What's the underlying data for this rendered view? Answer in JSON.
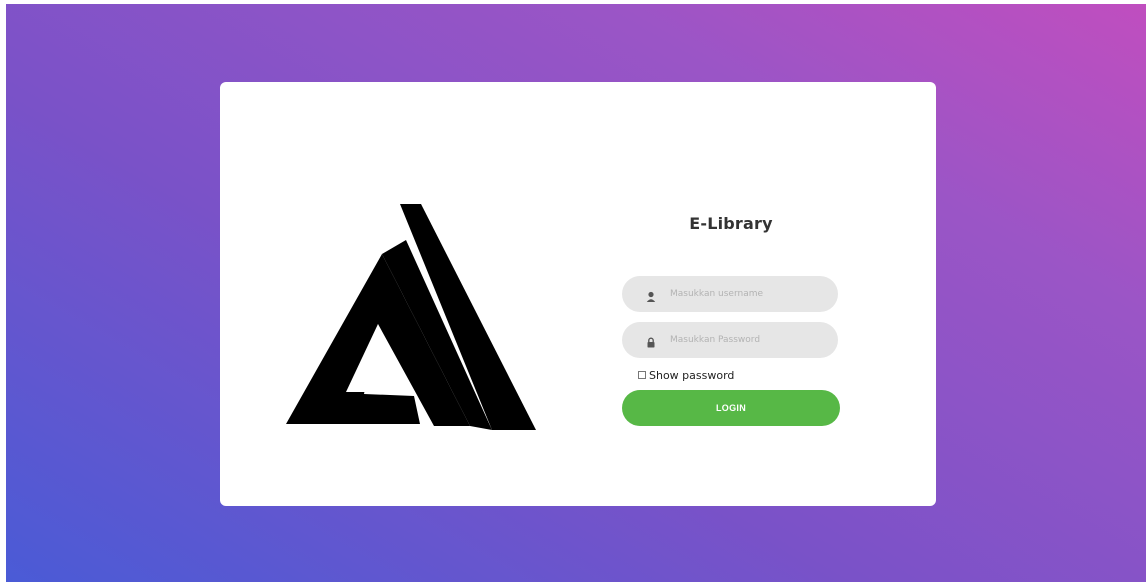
{
  "app": {
    "title": "E-Library"
  },
  "form": {
    "username": {
      "placeholder": "Masukkan username",
      "icon": "user-icon"
    },
    "password": {
      "placeholder": "Masukkan Password",
      "icon": "lock-icon"
    },
    "show_password": {
      "label": "Show password",
      "checked": false
    },
    "login_label": "LOGIN"
  },
  "logo": {
    "icon": "logo-triangle-icon"
  },
  "colors": {
    "gradient_start": "#4a5bd6",
    "gradient_end": "#c04ebf",
    "card_bg": "#ffffff",
    "input_bg": "#e6e6e6",
    "login_bg": "#57b846"
  }
}
